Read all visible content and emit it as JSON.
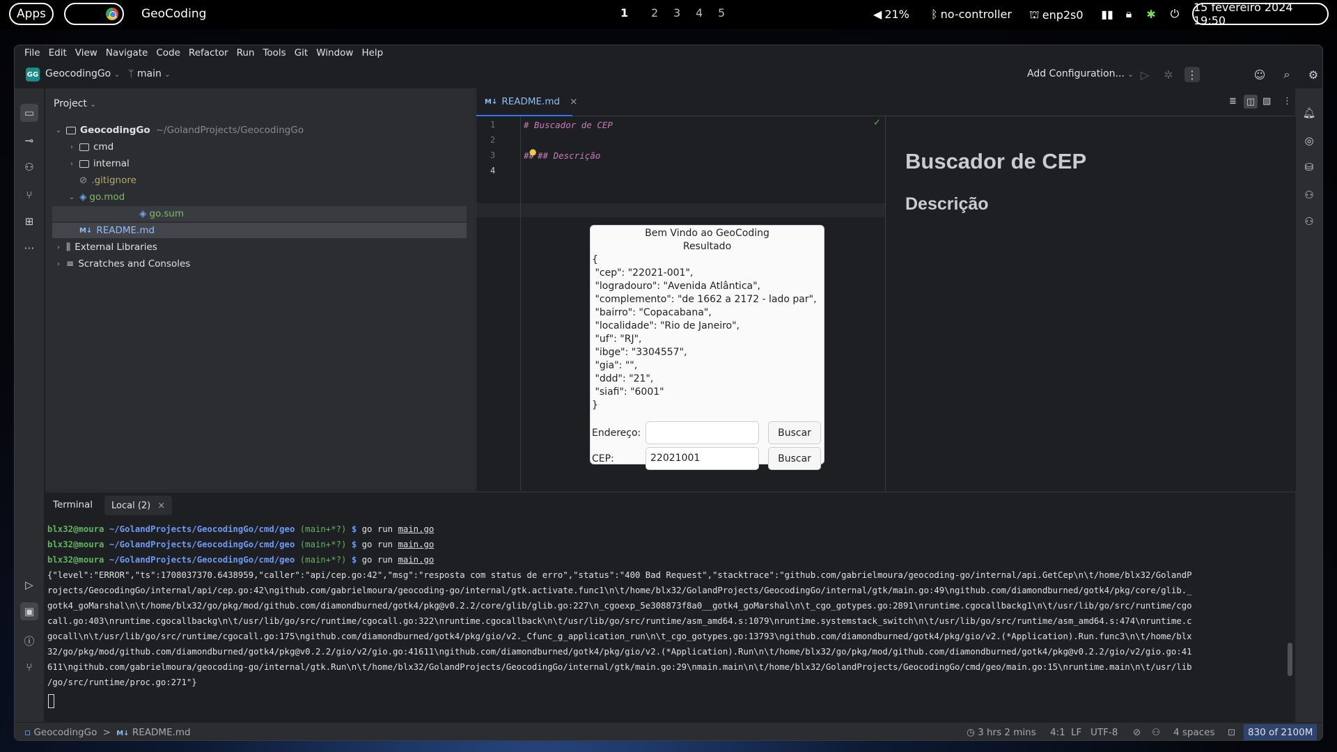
{
  "topbar": {
    "apps_label": "Apps",
    "app_name": "GeoCoding",
    "workspaces": [
      "1",
      "2",
      "3",
      "4",
      "5"
    ],
    "volume": "21%",
    "bluetooth": "no-controller",
    "network": "enp2s0",
    "clock": "15 fevereiro 2024 19:50"
  },
  "menu": [
    "File",
    "Edit",
    "View",
    "Navigate",
    "Code",
    "Refactor",
    "Run",
    "Tools",
    "Git",
    "Window",
    "Help"
  ],
  "toolbar": {
    "project_badge": "GG",
    "project_name": "GeocodingGo",
    "branch": "main",
    "add_configuration": "Add Configuration..."
  },
  "project_panel": {
    "title": "Project",
    "root_name": "GeocodingGo",
    "root_path": "~/GolandProjects/GeocodingGo",
    "items": [
      "cmd",
      "internal",
      ".gitignore",
      "go.mod",
      "go.sum",
      "README.md",
      "External Libraries",
      "Scratches and Consoles"
    ]
  },
  "editor": {
    "tab_badge": "M↓",
    "tab_name": "README.md",
    "line_numbers": [
      "1",
      "2",
      "3",
      "4"
    ],
    "lines": [
      "# Buscador de CEP",
      "",
      "## Descrição",
      ""
    ],
    "preview_h1": "Buscador de CEP",
    "preview_h2": "Descrição"
  },
  "dialog": {
    "title": "Bem Vindo ao GeoCoding",
    "subtitle": "Resultado",
    "json_lines": [
      "{",
      " \"cep\": \"22021-001\",",
      " \"logradouro\": \"Avenida Atlântica\",",
      " \"complemento\": \"de 1662 a 2172 - lado par\",",
      " \"bairro\": \"Copacabana\",",
      " \"localidade\": \"Rio de Janeiro\",",
      " \"uf\": \"RJ\",",
      " \"ibge\": \"3304557\",",
      " \"gia\": \"\",",
      " \"ddd\": \"21\",",
      " \"siafi\": \"6001\"",
      "}"
    ],
    "endereco_label": "Endereço:",
    "endereco_value": "",
    "cep_label": "CEP:",
    "cep_value": "22021001",
    "search_label": "Buscar"
  },
  "terminal": {
    "title": "Terminal",
    "tab": "Local (2)",
    "prompt_user": "blx32@moura",
    "prompt_path": "~/GolandProjects/GeocodingGo/cmd/geo",
    "prompt_branch": "(main+*?)",
    "prompt_symbol": "$",
    "command": "go run",
    "command_file": "main.go",
    "output_lines": [
      "{\"level\":\"ERROR\",\"ts\":1708037370.6438959,\"caller\":\"api/cep.go:42\",\"msg\":\"resposta com status de erro\",\"status\":\"400 Bad Request\",\"stacktrace\":\"github.com/gabrielmoura/geocoding-go/internal/api.GetCep\\n\\t/home/blx32/GolandP",
      "rojects/GeocodingGo/internal/api/cep.go:42\\ngithub.com/gabrielmoura/geocoding-go/internal/gtk.activate.func1\\n\\t/home/blx32/GolandProjects/GeocodingGo/internal/gtk/main.go:49\\ngithub.com/diamondburned/gotk4/pkg/core/glib._",
      "gotk4_goMarshal\\n\\t/home/blx32/go/pkg/mod/github.com/diamondburned/gotk4/pkg@v0.2.2/core/glib/glib.go:227\\n_cgoexp_5e308873f8a0__gotk4_goMarshal\\n\\t_cgo_gotypes.go:2891\\nruntime.cgocallbackg1\\n\\t/usr/lib/go/src/runtime/cgo",
      "call.go:403\\nruntime.cgocallbackg\\n\\t/usr/lib/go/src/runtime/cgocall.go:322\\nruntime.cgocallback\\n\\t/usr/lib/go/src/runtime/asm_amd64.s:1079\\nruntime.systemstack_switch\\n\\t/usr/lib/go/src/runtime/asm_amd64.s:474\\nruntime.c",
      "gocall\\n\\t/usr/lib/go/src/runtime/cgocall.go:175\\ngithub.com/diamondburned/gotk4/pkg/gio/v2._Cfunc_g_application_run\\n\\t_cgo_gotypes.go:13793\\ngithub.com/diamondburned/gotk4/pkg/gio/v2.(*Application).Run.func3\\n\\t/home/blx",
      "32/go/pkg/mod/github.com/diamondburned/gotk4/pkg@v0.2.2/gio/v2/gio.go:41611\\ngithub.com/diamondburned/gotk4/pkg/gio/v2.(*Application).Run\\n\\t/home/blx32/go/pkg/mod/github.com/diamondburned/gotk4/pkg@v0.2.2/gio/v2/gio.go:41",
      "611\\ngithub.com/gabrielmoura/geocoding-go/internal/gtk.Run\\n\\t/home/blx32/GolandProjects/GeocodingGo/internal/gtk/main.go:29\\nmain.main\\n\\t/home/blx32/GolandProjects/GeocodingGo/cmd/geo/main.go:15\\nruntime.main\\n\\t/usr/lib",
      "/go/src/runtime/proc.go:271\"}"
    ]
  },
  "statusbar": {
    "breadcrumb_project": "GeocodingGo",
    "breadcrumb_sep": ">",
    "breadcrumb_badge": "M↓",
    "breadcrumb_file": "README.md",
    "time_spent": "3 hrs 2 mins",
    "caret": "4:1",
    "line_sep": "LF",
    "encoding": "UTF-8",
    "indent": "4 spaces",
    "memory": "830 of 2100M"
  }
}
